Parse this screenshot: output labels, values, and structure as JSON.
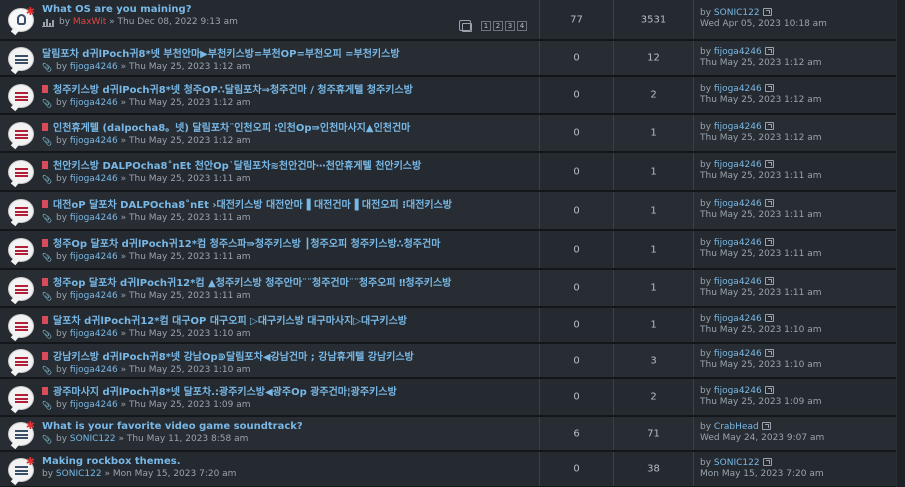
{
  "topics": [
    {
      "title": "What OS are you maining?",
      "author": "MaxWit",
      "author_color": "#e04545",
      "date": "Thu Dec 08, 2022 9:13 am",
      "replies": "77",
      "views": "3531",
      "last_user": "SONIC122",
      "last_date": "Wed Apr 05, 2023 10:18 am",
      "icon": "bulb",
      "meta_icon": "stats",
      "pages": [
        "1",
        "2",
        "3",
        "4"
      ]
    },
    {
      "title": "달림포차 d귀lPoch귀8*넷 부천안마▶부천키스방=부천OP=부천오피 =부천키스방",
      "author": "fijoga4246",
      "date": "Thu May 25, 2023 1:12 am",
      "replies": "0",
      "views": "12",
      "last_user": "fijoga4246",
      "last_date": "Thu May 25, 2023 1:12 am",
      "icon": "plain"
    },
    {
      "title": "청주키스방 d귀lPoch귀8*넷 청주OP∴달림포차⇒청주건마 / 청주휴게텔 청주키스방",
      "author": "fijoga4246",
      "date": "Thu May 25, 2023 1:12 am",
      "replies": "0",
      "views": "2",
      "last_user": "fijoga4246",
      "last_date": "Thu May 25, 2023 1:12 am",
      "icon": "red"
    },
    {
      "title": "인천휴게텔 (dalpocha8。넷) 달림포차¨인천오피 ∶인천Op⇛인천마사지▲인천건마",
      "author": "fijoga4246",
      "date": "Thu May 25, 2023 1:12 am",
      "replies": "0",
      "views": "1",
      "last_user": "fijoga4246",
      "last_date": "Thu May 25, 2023 1:12 am",
      "icon": "red"
    },
    {
      "title": "천안키스방 DALPOcha8˚nEt 천안Op˙달림포차≋천안건마⋯천안휴게텔 천안키스방",
      "author": "fijoga4246",
      "date": "Thu May 25, 2023 1:11 am",
      "replies": "0",
      "views": "1",
      "last_user": "fijoga4246",
      "last_date": "Thu May 25, 2023 1:11 am",
      "icon": "red"
    },
    {
      "title": "대전oP 달포차 DALPOcha8˚nEt ›대전키스방 대전안마▐ 대전건마▐ 대전오피 ⁝대전키스방",
      "author": "fijoga4246",
      "date": "Thu May 25, 2023 1:11 am",
      "replies": "0",
      "views": "1",
      "last_user": "fijoga4246",
      "last_date": "Thu May 25, 2023 1:11 am",
      "icon": "red"
    },
    {
      "title": "청주Op 달포차 d귀lPoch귀12*컴 청주스파⇛청주키스방 ┃청주오피 청주키스방∴청주건마",
      "author": "fijoga4246",
      "date": "Thu May 25, 2023 1:11 am",
      "replies": "0",
      "views": "1",
      "last_user": "fijoga4246",
      "last_date": "Thu May 25, 2023 1:11 am",
      "icon": "red"
    },
    {
      "title": "청주op 달포차 d귀lPoch귀12*컴 ▲청주키스방 청주안마¨¨청주건마¨¨청주오피 ‼청주키스방",
      "author": "fijoga4246",
      "date": "Thu May 25, 2023 1:11 am",
      "replies": "0",
      "views": "1",
      "last_user": "fijoga4246",
      "last_date": "Thu May 25, 2023 1:11 am",
      "icon": "red"
    },
    {
      "title": "달포차 d귀lPoch귀12*컴 대구OP 대구오피 ▷대구키스방 대구마사지▷대구키스방",
      "author": "fijoga4246",
      "date": "Thu May 25, 2023 1:10 am",
      "replies": "0",
      "views": "1",
      "last_user": "fijoga4246",
      "last_date": "Thu May 25, 2023 1:10 am",
      "icon": "red"
    },
    {
      "title": "강남키스방 d귀lPoch귀8*넷 강남Op⋑달림포차◀강남건마 ; 강남휴게텔 강남키스방",
      "author": "fijoga4246",
      "date": "Thu May 25, 2023 1:10 am",
      "replies": "0",
      "views": "3",
      "last_user": "fijoga4246",
      "last_date": "Thu May 25, 2023 1:10 am",
      "icon": "red"
    },
    {
      "title": "광주마사지 d귀lPoch귀8*넷 달포차.:광주키스방◀광주Op 광주건마¦광주키스방",
      "author": "fijoga4246",
      "date": "Thu May 25, 2023 1:09 am",
      "replies": "0",
      "views": "2",
      "last_user": "fijoga4246",
      "last_date": "Thu May 25, 2023 1:09 am",
      "icon": "red"
    },
    {
      "title": "What is your favorite video game soundtrack?",
      "author": "SONIC122",
      "date": "Thu May 11, 2023 8:58 am",
      "replies": "6",
      "views": "71",
      "last_user": "CrabHead",
      "last_date": "Wed May 24, 2023 9:07 am",
      "icon": "plain-star",
      "meta_icon": "clip"
    },
    {
      "title": "Making rockbox themes.",
      "author": "SONIC122",
      "date": "Mon May 15, 2023 7:20 am",
      "replies": "0",
      "views": "38",
      "last_user": "SONIC122",
      "last_date": "Mon May 15, 2023 7:20 am",
      "icon": "plain-star",
      "meta_icon": "none"
    }
  ],
  "labels": {
    "by": "by",
    "sep": "»"
  }
}
